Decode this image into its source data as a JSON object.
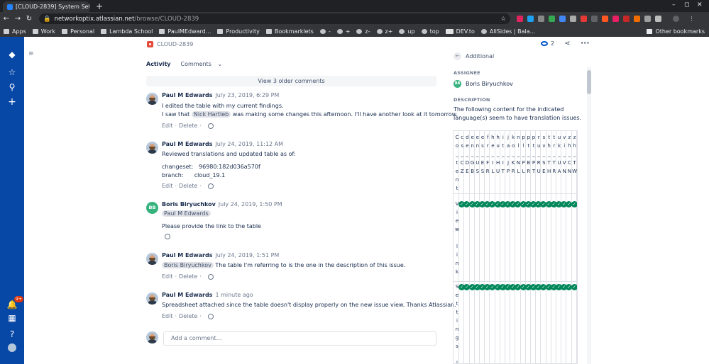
{
  "browser": {
    "tab_title": "[CLOUD-2839] System Set",
    "url_domain": "networkoptix.atlassian.net",
    "url_path": "/browse/CLOUD-2839",
    "bookmarks": [
      "Apps",
      "Work",
      "Personal",
      "Lambda School",
      "PaulMEdward...",
      "Productivity",
      "Bookmarklets",
      "-",
      "+",
      "z-",
      "z+",
      "up",
      "top",
      "DEV.to",
      "AllSides | Bala..."
    ],
    "other_bookmarks": "Other bookmarks"
  },
  "sidebar": {
    "notification_badge": "9+"
  },
  "issue": {
    "key": "CLOUD-2839",
    "watchers": "2"
  },
  "activity": {
    "label": "Activity",
    "filter": "Comments",
    "older": "View 3 older comments"
  },
  "comments": [
    {
      "author": "Paul M Edwards",
      "date": "July 23, 2019, 6:29 PM",
      "line1": "I edited the table with my current findings.",
      "line2_pre": "I saw that",
      "line2_mention": "Nick Hartleb",
      "line2_post": "was making some changes this afternoon. I'll have another look at it tomorrow.",
      "edit": "Edit",
      "delete": "Delete"
    },
    {
      "author": "Paul M Edwards",
      "date": "July 24, 2019, 11:12 AM",
      "line1": "Reviewed translations and updated table as of:",
      "changeset_label": "changeset:",
      "changeset": "96980:182d036a570f",
      "branch_label": "branch:",
      "branch": "cloud_19.1",
      "edit": "Edit",
      "delete": "Delete"
    },
    {
      "author": "Boris Biryuchkov",
      "initials": "BB",
      "date": "July 24, 2019, 1:50 PM",
      "mention": "Paul M Edwards",
      "line1": "Please provide the link to the table"
    },
    {
      "author": "Paul M Edwards",
      "date": "July 24, 2019, 1:51 PM",
      "mention": "Boris Biryuchkov",
      "line1": "The table I'm referring to is the one in the description of this issue.",
      "edit": "Edit",
      "delete": "Delete"
    },
    {
      "author": "Paul M Edwards",
      "date": "1 minute ago",
      "line1": "Spreadsheet attached since the table doesn't display properly on the new issue view. Thanks Atlassian.",
      "edit": "Edit",
      "delete": "Delete"
    }
  ],
  "add_comment_placeholder": "Add a comment…",
  "panel": {
    "title": "Additional",
    "assignee_label": "ASSIGNEE",
    "assignee": "Boris Biryuchkov",
    "assignee_initials": "BB",
    "description_label": "DESCRIPTION",
    "description": "The following content for the indicated language(s) seem to have translation issues."
  },
  "table": {
    "row1": [
      "C",
      "c",
      "d",
      "e",
      "e",
      "e",
      "f",
      "h",
      "h",
      "i",
      "j",
      "k",
      "n",
      "p",
      "p",
      "p",
      "r",
      "s",
      "t",
      "t",
      "u",
      "v",
      "z",
      "z"
    ],
    "row2": [
      "o",
      "s",
      "e",
      "n",
      "n",
      "s",
      "r",
      "e",
      "u",
      "t",
      "a",
      "o",
      "l",
      "l",
      "t",
      "t",
      "u",
      "v",
      "h",
      "r",
      "k",
      "i",
      "h",
      "h"
    ],
    "row4": [
      "t",
      "C",
      "D",
      "G",
      "U",
      "E",
      "F",
      "I",
      "H",
      "I",
      "J",
      "K",
      "N",
      "P",
      "B",
      "P",
      "R",
      "S",
      "T",
      "T",
      "U",
      "V",
      "C",
      "T"
    ],
    "row5": [
      "e",
      "Z",
      "E",
      "B",
      "S",
      "S",
      "R",
      "L",
      "U",
      "T",
      "P",
      "R",
      "L",
      "L",
      "R",
      "T",
      "U",
      "E",
      "H",
      "R",
      "A",
      "N",
      "N",
      "W"
    ],
    "first_col": [
      "n",
      "t"
    ],
    "row_a_label": [
      "V",
      "i",
      "e",
      "w",
      "",
      "l",
      "i",
      "n",
      "k"
    ],
    "row_b_label": [
      "S",
      "e",
      "t",
      "t",
      "i",
      "n",
      "g",
      "s",
      "",
      "l"
    ]
  }
}
